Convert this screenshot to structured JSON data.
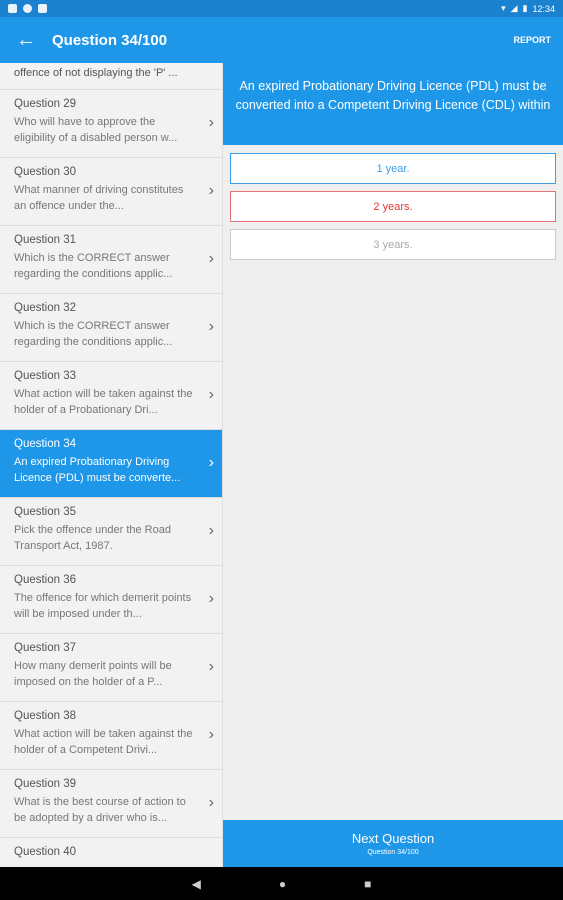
{
  "status_bar": {
    "time": "12:34"
  },
  "app_bar": {
    "title": "Question 34/100",
    "report_label": "REPORT"
  },
  "sidebar": {
    "partial_text": "offence of not displaying the 'P' ...",
    "items": [
      {
        "title": "Question 29",
        "text": "Who will have to approve the eligibility of a disabled person w..."
      },
      {
        "title": "Question 30",
        "text": "What manner of driving constitutes an offence under the..."
      },
      {
        "title": "Question 31",
        "text": "Which is the CORRECT answer regarding the conditions applic..."
      },
      {
        "title": "Question 32",
        "text": "Which is the CORRECT answer regarding the conditions applic..."
      },
      {
        "title": "Question 33",
        "text": "What action will be taken against the holder of a Probationary Dri..."
      },
      {
        "title": "Question 34",
        "text": "An expired Probationary Driving Licence (PDL) must be converte..."
      },
      {
        "title": "Question 35",
        "text": "Pick the offence under the Road Transport Act, 1987."
      },
      {
        "title": "Question 36",
        "text": "The offence for which demerit points will be imposed under th..."
      },
      {
        "title": "Question 37",
        "text": "How many demerit points will be imposed on the holder of a P..."
      },
      {
        "title": "Question 38",
        "text": "What action will be taken against the holder of a Competent Drivi..."
      },
      {
        "title": "Question 39",
        "text": "What is the best course of action to be adopted by a driver who is..."
      },
      {
        "title": "Question 40",
        "text": ""
      }
    ]
  },
  "question": {
    "text": "An expired Probationary Driving Licence (PDL) must be converted into a Competent Driving Licence (CDL) within",
    "answers": [
      {
        "label": "1 year.",
        "state": "correct"
      },
      {
        "label": "2 years.",
        "state": "wrong"
      },
      {
        "label": "3 years.",
        "state": "neutral"
      }
    ]
  },
  "footer": {
    "next_label": "Next Question",
    "progress_label": "Question 34/100"
  }
}
